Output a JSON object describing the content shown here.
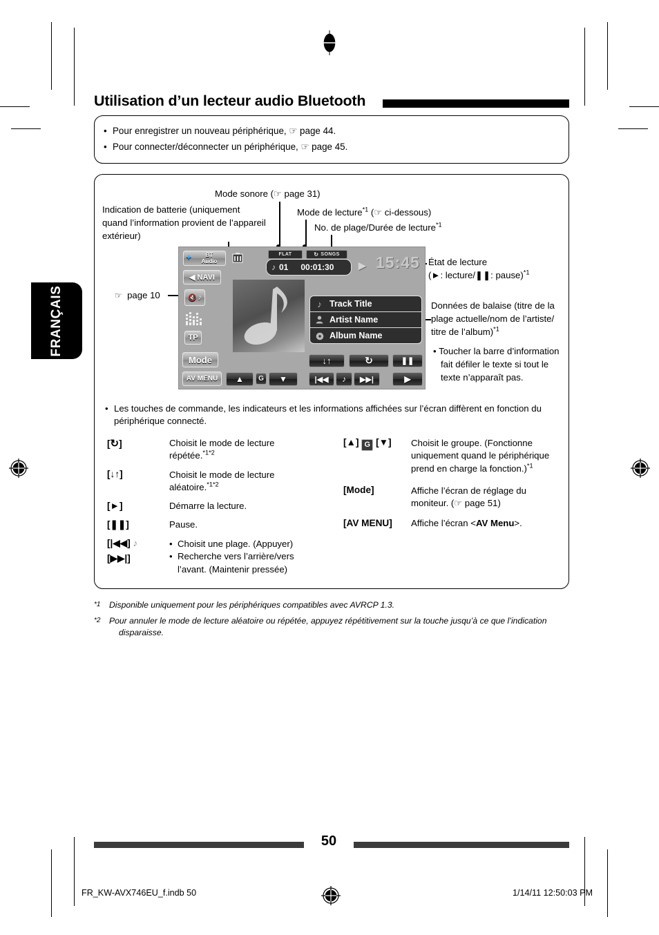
{
  "page": {
    "title": "Utilisation d’un lecteur audio Bluetooth",
    "language_tab": "FRANÇAIS",
    "number": "50",
    "footer_file": "FR_KW-AVX746EU_f.indb   50",
    "footer_date": "1/14/11   12:50:03 PM"
  },
  "note_box": {
    "bullet": "•",
    "items": [
      "Pour enregistrer un nouveau périphérique, ☞ page 44.",
      "Pour connecter/déconnecter un périphérique, ☞ page 45."
    ]
  },
  "callouts": {
    "sound_mode": "Mode sonore (☞ page 31)",
    "battery_l1": "Indication de batterie (uniquement",
    "battery_l2": "quand l’information provient de l’appareil",
    "battery_l3": "extérieur)",
    "play_mode": "Mode de lecture*1 (☞ ci-dessous)",
    "track_time": "No. de plage/Durée de lecture*1",
    "page10": "☞ page 10",
    "play_status_l1": "État de lecture",
    "play_status_l2": "(►: lecture/❚❚: pause) *1",
    "tag_data_l1": "Données de balaise (titre de la",
    "tag_data_l2": "plage actuelle/nom de l’artiste/",
    "tag_data_l3": "titre de l’album)*1",
    "tag_bullet": "•",
    "tag_sub_l1": "Toucher la barre d’information",
    "tag_sub_l2": "fait défiler le texte si tout le",
    "tag_sub_l3": "texte n’apparaît pas."
  },
  "device": {
    "source_button_l1": "BT",
    "source_button_l2": "Audio",
    "navi_button": "NAVI",
    "tp_button": "TP",
    "mode_button": "Mode",
    "av_menu_button": "AV MENU",
    "group_letter": "G",
    "badge_sound": "FLAT",
    "badge_repeat": "SONGS",
    "track_number": "01",
    "play_time": "00:01:30",
    "clock": "15:45",
    "info_rows": [
      {
        "icon": "music-note-icon",
        "glyph": "♪",
        "label": "Track Title"
      },
      {
        "icon": "person-icon",
        "glyph": "👤",
        "label": "Artist Name"
      },
      {
        "icon": "disc-icon",
        "glyph": "◉",
        "label": "Album Name"
      }
    ],
    "transport": {
      "random": "↓↑",
      "repeat": "↻",
      "pause": "❚❚",
      "prev": "◀◀",
      "note": "♪",
      "next": "▶▶",
      "play": "▶",
      "up": "▲",
      "down": "▼"
    }
  },
  "intro_bullet": {
    "bullet": "•",
    "line1": "Les touches de commande, les indicateurs et les informations affichées sur l’écran diffèrent en fonction du",
    "line2": "périphérique connecté."
  },
  "legend_left": [
    {
      "key": "[↻]",
      "desc_l1": "Choisit le mode de lecture",
      "desc_l2": "répétée.*1*2"
    },
    {
      "key": "[↓↑]",
      "desc_l1": "Choisit le mode de lecture",
      "desc_l2": "aléatoire.*1*2"
    },
    {
      "key": "[►]",
      "desc_l1": "Démarre la lecture.",
      "desc_l2": ""
    },
    {
      "key": "[❚❚]",
      "desc_l1": "Pause.",
      "desc_l2": ""
    },
    {
      "key": "[|◀◀] ♪",
      "key2": "[▶▶|]",
      "sub1": "Choisit une plage. (Appuyer)",
      "sub2_l1": "Recherche vers l’arrière/vers",
      "sub2_l2": "l’avant. (Maintenir pressée)"
    }
  ],
  "legend_right": [
    {
      "key_pre": "[▲]",
      "key_box": "G",
      "key_post": "[▼]",
      "desc_l1": "Choisit le groupe. (Fonctionne",
      "desc_l2": "uniquement quand le périphérique",
      "desc_l3": "prend en charge la fonction.)*1"
    },
    {
      "key": "[Mode]",
      "desc_l1": "Affiche l’écran de réglage du",
      "desc_l2": "moniteur. (☞  page 51)"
    },
    {
      "key": "[AV MENU]",
      "desc_l1": "Affiche l’écran <AV Menu>."
    }
  ],
  "footnotes": [
    {
      "mark": "*1",
      "text": "Disponible uniquement pour les périphériques compatibles avec AVRCP 1.3."
    },
    {
      "mark": "*2",
      "line1": "Pour annuler le mode de lecture aléatoire ou répétée, appuyez répétitivement sur la touche jusqu’à ce que l’indication",
      "line2": "disparaisse."
    }
  ]
}
